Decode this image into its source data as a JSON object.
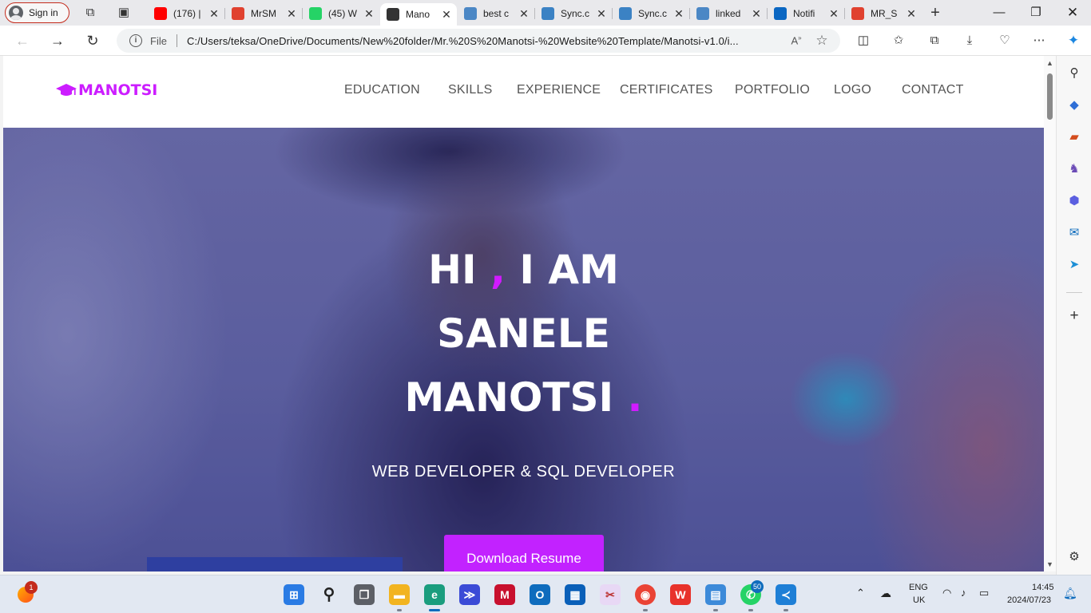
{
  "browser": {
    "signin_label": "Sign in",
    "tabs": [
      {
        "title": "(176) |",
        "favicon": "youtube-icon",
        "color": "#ff0000",
        "active": false
      },
      {
        "title": "MrSM",
        "favicon": "pdf-icon",
        "color": "#e0412f",
        "active": false
      },
      {
        "title": "(45) W",
        "favicon": "whatsapp-icon",
        "color": "#25d366",
        "active": false
      },
      {
        "title": "Mano",
        "favicon": "site-icon",
        "color": "#333333",
        "active": true
      },
      {
        "title": "best c",
        "favicon": "search-icon",
        "color": "#4b87c5",
        "active": false
      },
      {
        "title": "Sync.c",
        "favicon": "sync-icon",
        "color": "#3b82c4",
        "active": false
      },
      {
        "title": "Sync.c",
        "favicon": "sync-icon",
        "color": "#3b82c4",
        "active": false
      },
      {
        "title": "linked",
        "favicon": "search-icon",
        "color": "#4b87c5",
        "active": false
      },
      {
        "title": "Notifi",
        "favicon": "linkedin-icon",
        "color": "#0a66c2",
        "active": false
      },
      {
        "title": "MR_S",
        "favicon": "pdf-icon",
        "color": "#e0412f",
        "active": false
      }
    ],
    "address": {
      "scheme_label": "File",
      "url": "C:/Users/teksa/OneDrive/Documents/New%20folder/Mr.%20S%20Manotsi-%20Website%20Template/Manotsi-v1.0/i..."
    }
  },
  "site": {
    "logo_text": "MANOTSI",
    "accent_color": "#cc1dff",
    "nav": [
      "EDUCATION",
      "SKILLS",
      "EXPERIENCE",
      "CERTIFICATES",
      "PORTFOLIO",
      "LOGO",
      "CONTACT"
    ],
    "hero": {
      "line1_a": "HI ",
      "line1_comma": ",",
      "line1_b": " I AM",
      "line2": "SANELE",
      "line3": "MANOTSI ",
      "line3_dot": ".",
      "subtitle": "WEB DEVELOPER & SQL DEVELOPER",
      "cta_label": "Download Resume"
    }
  },
  "taskbar": {
    "notification_badge": "1",
    "whatsapp_badge": "50",
    "language": "ENG",
    "region": "UK",
    "time": "14:45",
    "date": "2024/07/23"
  }
}
